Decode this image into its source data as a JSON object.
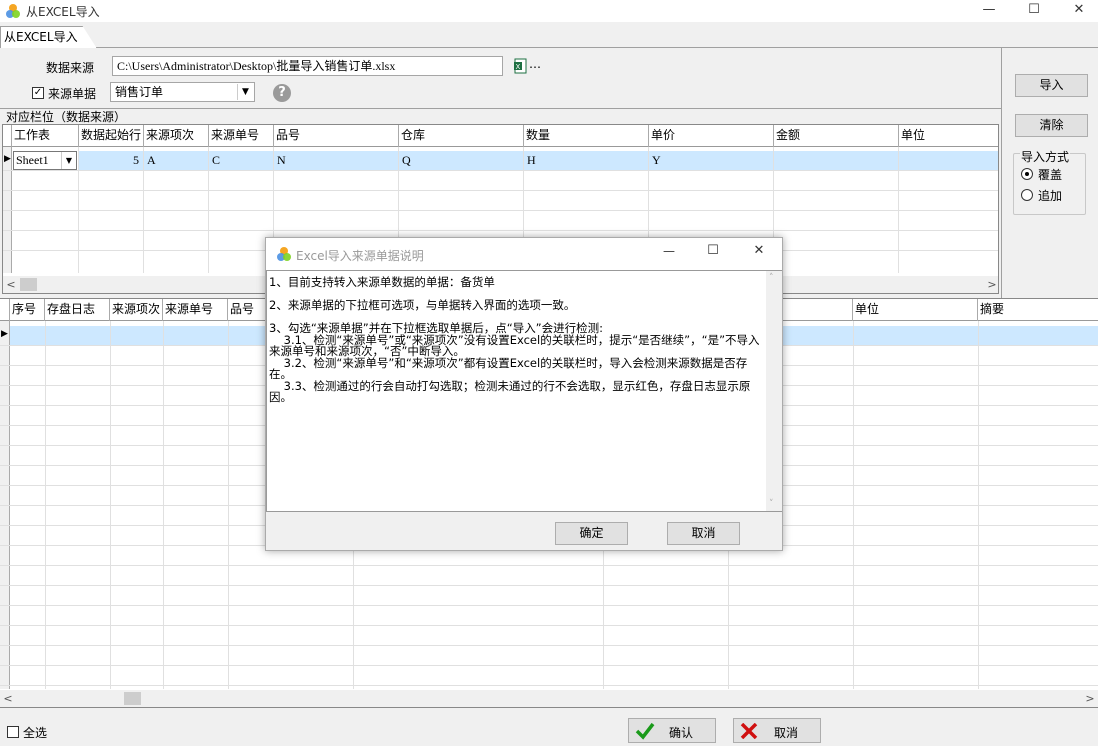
{
  "window": {
    "title": "从EXCEL导入"
  },
  "tab": {
    "label": "从EXCEL导入"
  },
  "form": {
    "source_label": "数据来源",
    "source_path": "C:\\Users\\Administrator\\Desktop\\批量导入销售订单.xlsx",
    "browse_label": "…",
    "source_doc_label": "来源单据",
    "source_doc_checked": true,
    "source_doc_value": "销售订单"
  },
  "mapping_section_label": "对应栏位（数据来源）",
  "mapping_grid": {
    "columns": [
      "工作表",
      "数据起始行",
      "来源项次",
      "来源单号",
      "品号",
      "仓库",
      "数量",
      "单价",
      "金额",
      "单位"
    ],
    "row": [
      "Sheet1",
      "5",
      "A",
      "C",
      "N",
      "Q",
      "H",
      "Y",
      "",
      ""
    ]
  },
  "side": {
    "import_button": "导入",
    "clear_button": "清除",
    "mode_label": "导入方式",
    "mode_options": [
      "覆盖",
      "追加"
    ],
    "mode_selected": "覆盖"
  },
  "result_grid": {
    "columns": [
      "序号",
      "存盘日志",
      "来源项次",
      "来源单号",
      "品号",
      "单位",
      "摘要"
    ]
  },
  "footer": {
    "select_all_label": "全选",
    "confirm_button": "确认",
    "cancel_button": "取消"
  },
  "dialog": {
    "title": "Excel导入来源单据说明",
    "text": "1、目前支持转入来源单数据的单据：备货单\n\n2、来源单据的下拉框可选项，与单据转入界面的选项一致。\n\n3、勾选“来源单据”并在下拉框选取单据后，点“导入”会进行检测:\n    3.1、检测“来源单号”或“来源项次”没有设置Excel的关联栏时，提示“是否继续”，“是”不导入来源单号和来源项次，“否”中断导入。\n    3.2、检测“来源单号”和“来源项次”都有设置Excel的关联栏时，导入会检测来源数据是否存在。\n    3.3、检测通过的行会自动打勾选取；检测未通过的行不会选取，显示红色，存盘日志显示原因。",
    "ok_button": "确定",
    "cancel_button": "取消"
  },
  "colors": {
    "selected_row": "#cde8ff",
    "confirm_icon": "#1a9a1a",
    "cancel_icon": "#d01010"
  }
}
